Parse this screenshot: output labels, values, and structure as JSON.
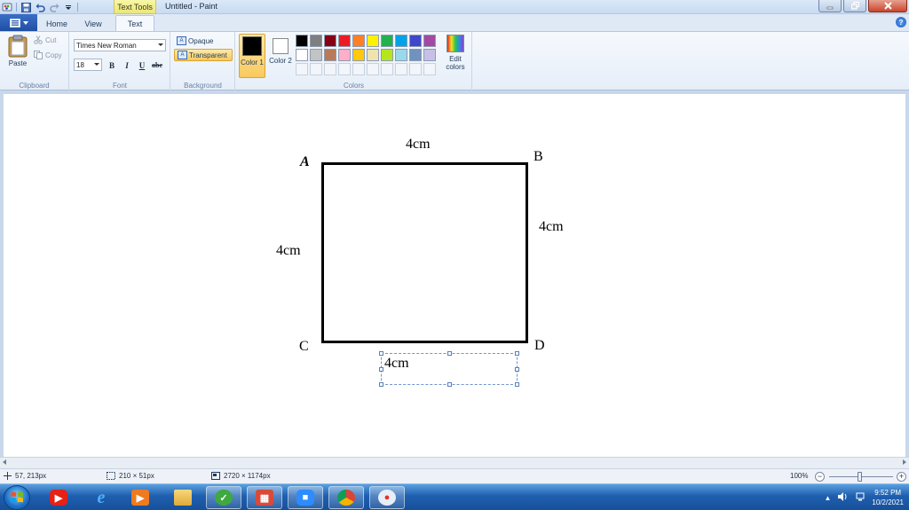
{
  "window": {
    "title": "Untitled - Paint",
    "context_tab": "Text Tools"
  },
  "tabs": {
    "home": "Home",
    "view": "View",
    "text": "Text"
  },
  "clipboard": {
    "paste": "Paste",
    "cut": "Cut",
    "copy": "Copy",
    "group_label": "Clipboard"
  },
  "font": {
    "family": "Times New Roman",
    "size": "18",
    "bold": "B",
    "italic": "I",
    "underline": "U",
    "strike": "abc",
    "group_label": "Font"
  },
  "background": {
    "opaque": "Opaque",
    "transparent": "Transparent",
    "group_label": "Background"
  },
  "colors": {
    "color1_label": "Color 1",
    "color2_label": "Color 2",
    "edit_label": "Edit colors",
    "group_label": "Colors",
    "color1": "#000000",
    "color2": "#ffffff",
    "palette_row1": [
      "#000000",
      "#7f7f7f",
      "#880015",
      "#ed1c24",
      "#ff7f27",
      "#fff200",
      "#22b14c",
      "#00a2e8",
      "#3f48cc",
      "#a349a4"
    ],
    "palette_row2": [
      "#ffffff",
      "#c3c3c3",
      "#b97a57",
      "#ffaec9",
      "#ffc90e",
      "#efe4b0",
      "#b5e61d",
      "#99d9ea",
      "#7092be",
      "#c8bfe7"
    ]
  },
  "canvas": {
    "vertex_a": "A",
    "vertex_b": "B",
    "vertex_c": "C",
    "vertex_d": "D",
    "side_top": "4cm",
    "side_right": "4cm",
    "side_left": "4cm",
    "textbox_text": "4cm"
  },
  "status": {
    "cursor": "57, 213px",
    "selection": "210 × 51px",
    "image_size": "2720 × 1174px",
    "zoom": "100%"
  },
  "taskbar": {
    "time": "9:52 PM",
    "date": "10/2/2021"
  }
}
